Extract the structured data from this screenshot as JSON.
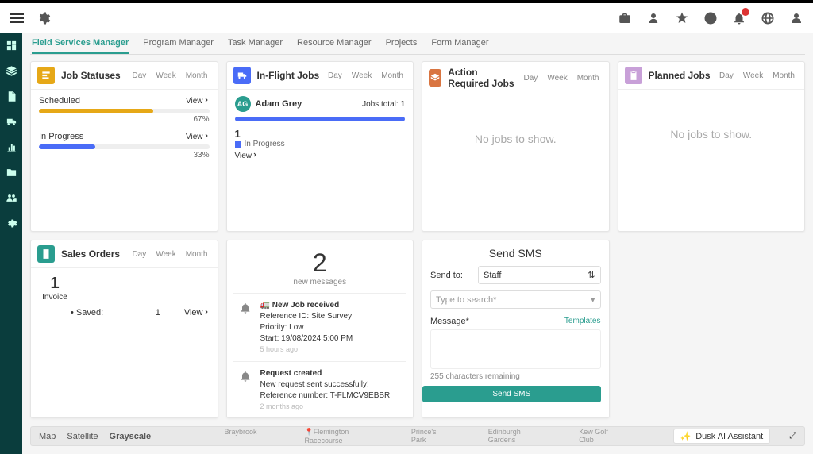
{
  "tabs": [
    "Field Services Manager",
    "Program Manager",
    "Task Manager",
    "Resource Manager",
    "Projects",
    "Form Manager"
  ],
  "active_tab": 0,
  "time_toggles": [
    "Day",
    "Week",
    "Month"
  ],
  "job_statuses": {
    "title": "Job Statuses",
    "items": [
      {
        "name": "Scheduled",
        "view": "View",
        "pct": "67%",
        "width": "67%",
        "color": "#e6a817"
      },
      {
        "name": "In Progress",
        "view": "View",
        "pct": "33%",
        "width": "33%",
        "color": "#4a6cf7"
      }
    ]
  },
  "inflight": {
    "title": "In-Flight Jobs",
    "person_initials": "AG",
    "person": "Adam Grey",
    "jobs_total_label": "Jobs total:",
    "jobs_total": "1",
    "count": "1",
    "legend": "In Progress",
    "view": "View"
  },
  "action_required": {
    "title": "Action Required Jobs",
    "empty": "No jobs to show."
  },
  "planned": {
    "title": "Planned Jobs",
    "empty": "No jobs to show."
  },
  "sales": {
    "title": "Sales Orders",
    "big_number": "1",
    "big_label": "Invoice",
    "saved_label": "• Saved:",
    "saved_count": "1",
    "view": "View"
  },
  "messages": {
    "count": "2",
    "sub": "new messages",
    "items": [
      {
        "emoji": "🚛",
        "title": "New Job received",
        "line1": "Reference ID: Site Survey",
        "line2": "Priority: Low",
        "line3": "Start: 19/08/2024 5:00 PM",
        "time": "5 hours ago"
      },
      {
        "emoji": "",
        "title": "Request created",
        "line1": "New request sent successfully!",
        "line2": "Reference number: T-FLMCV9EBBR",
        "line3": "",
        "time": "2 months ago"
      }
    ]
  },
  "sms": {
    "title": "Send SMS",
    "send_to_label": "Send to:",
    "send_to_value": "Staff",
    "search_placeholder": "Type to search*",
    "message_label": "Message*",
    "templates": "Templates",
    "chars": "255 characters remaining",
    "send": "Send SMS"
  },
  "map": {
    "types": [
      "Map",
      "Satellite",
      "Grayscale"
    ],
    "active": 2,
    "places": [
      "Braybrook",
      "Flemington Racecourse",
      "Prince's Park",
      "Edinburgh Gardens",
      "Kew Golf Club"
    ],
    "ai": "Dusk AI Assistant"
  },
  "colors": {
    "job_statuses_icon": "#e6a817",
    "inflight_icon": "#4a6cf7",
    "action_icon": "#d97541",
    "planned_icon": "#c8a0d8",
    "sales_icon": "#2a9d8f"
  }
}
